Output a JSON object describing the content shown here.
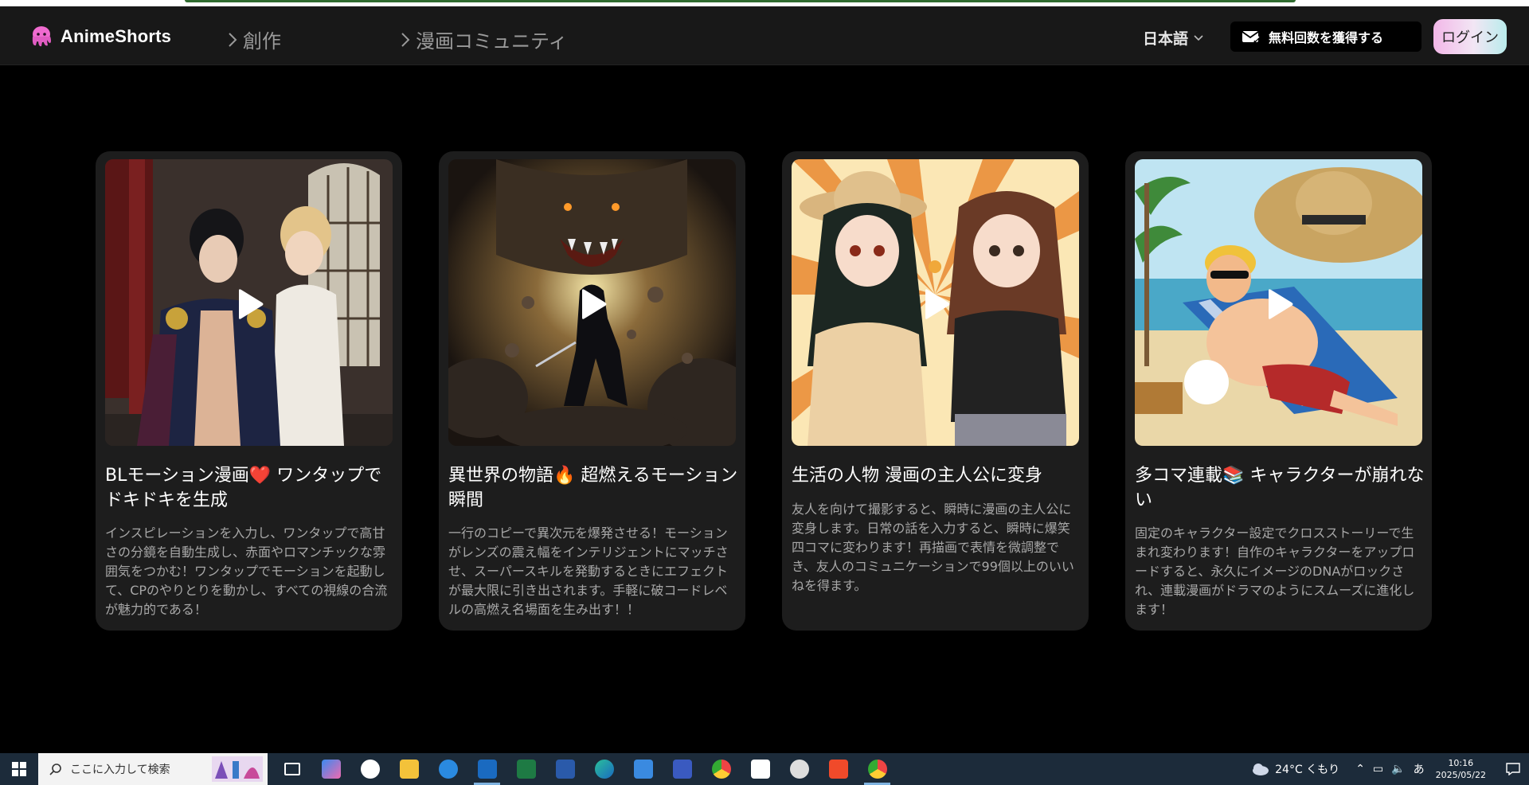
{
  "header": {
    "brand_name": "AnimeShorts",
    "nav": [
      {
        "label": "創作"
      },
      {
        "label": "漫画コミュニティ"
      }
    ],
    "language": "日本語",
    "free_button": "無料回数を獲得する",
    "login_button": "ログイン"
  },
  "cards": [
    {
      "title": "BLモーション漫画❤️ ワンタップでドキドキを生成",
      "description": "インスピレーションを入力し、ワンタップで高甘さの分鏡を自動生成し、赤面やロマンチックな雰囲気をつかむ！ワンタップでモーションを起動して、CPのやりとりを動かし、すべての視線の合流が魅力的である！"
    },
    {
      "title": "異世界の物語🔥 超燃えるモーション瞬間",
      "description": "一行のコピーで異次元を爆発させる！モーションがレンズの震え幅をインテリジェントにマッチさせ、スーパースキルを発動するときにエフェクトが最大限に引き出されます。手軽に破コードレベルの高燃え名場面を生み出す！！"
    },
    {
      "title": "生活の人物 漫画の主人公に変身",
      "description": "友人を向けて撮影すると、瞬時に漫画の主人公に変身します。日常の話を入力すると、瞬時に爆笑四コマに変わります！再描画で表情を微調整でき、友人のコミュニケーションで99個以上のいいねを得ます。"
    },
    {
      "title": "多コマ連載📚 キャラクターが崩れない",
      "description": "固定のキャラクター設定でクロスストーリーで生まれ変わります！自作のキャラクターをアップロードすると、永久にイメージのDNAがロックされ、連載漫画がドラマのようにスムーズに進化します！"
    }
  ],
  "taskbar": {
    "search_placeholder": "ここに入力して検索",
    "weather": "24°C くもり",
    "ime": "あ",
    "time": "10:16",
    "date": "2025/05/22"
  },
  "colors": {
    "background": "#000000",
    "header_bg": "#181818",
    "card_bg": "#1d1d1d",
    "brand_pink": "#f06bd0",
    "taskbar_bg": "#1c2b3a"
  }
}
